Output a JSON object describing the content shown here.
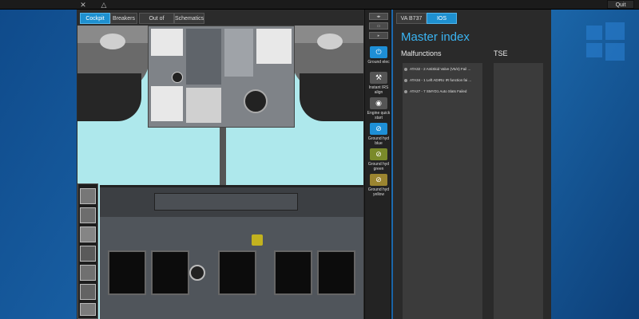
{
  "topbar": {
    "quit_label": "Quit",
    "icons": [
      "tools-icon",
      "warning-icon"
    ]
  },
  "left_tabs": [
    {
      "label": "Cockpit",
      "active": true
    },
    {
      "label": "Breakers",
      "active": false
    },
    {
      "label": "Out of Cockpit",
      "active": false
    },
    {
      "label": "Schematics",
      "active": false
    }
  ],
  "sidebar": {
    "buttons": [
      {
        "label": "Ground elec",
        "icon": "power-icon",
        "style": "blue"
      },
      {
        "label": "Instant IRS align",
        "icon": "tools-icon",
        "style": "dark"
      },
      {
        "label": "Engine quick start",
        "icon": "engine-icon",
        "style": "dark"
      },
      {
        "label": "Ground hyd blue",
        "icon": "hydraulic-icon",
        "style": "blue"
      },
      {
        "label": "Ground hyd green",
        "icon": "hydraulic-icon",
        "style": "green"
      },
      {
        "label": "Ground hyd yellow",
        "icon": "hydraulic-icon",
        "style": "gold"
      }
    ]
  },
  "master": {
    "tabs": [
      {
        "label": "VA B737",
        "active": false
      },
      {
        "label": "IOS",
        "active": true
      }
    ],
    "title": "Master index",
    "malfunctions_header": "Malfunctions",
    "tse_header": "TSE",
    "malfunctions": [
      "ATA32 - 2 AntiSkid Valve (V5/4) Fail ...",
      "ATA34 - 1 Left ADIRU IR function fai ...",
      "ATA27 - 7 SMYD1 Auto Slats Failed"
    ]
  },
  "colors": {
    "accent": "#1e90d0",
    "title_blue": "#3ab4f2",
    "desktop": "#1a63a8"
  }
}
